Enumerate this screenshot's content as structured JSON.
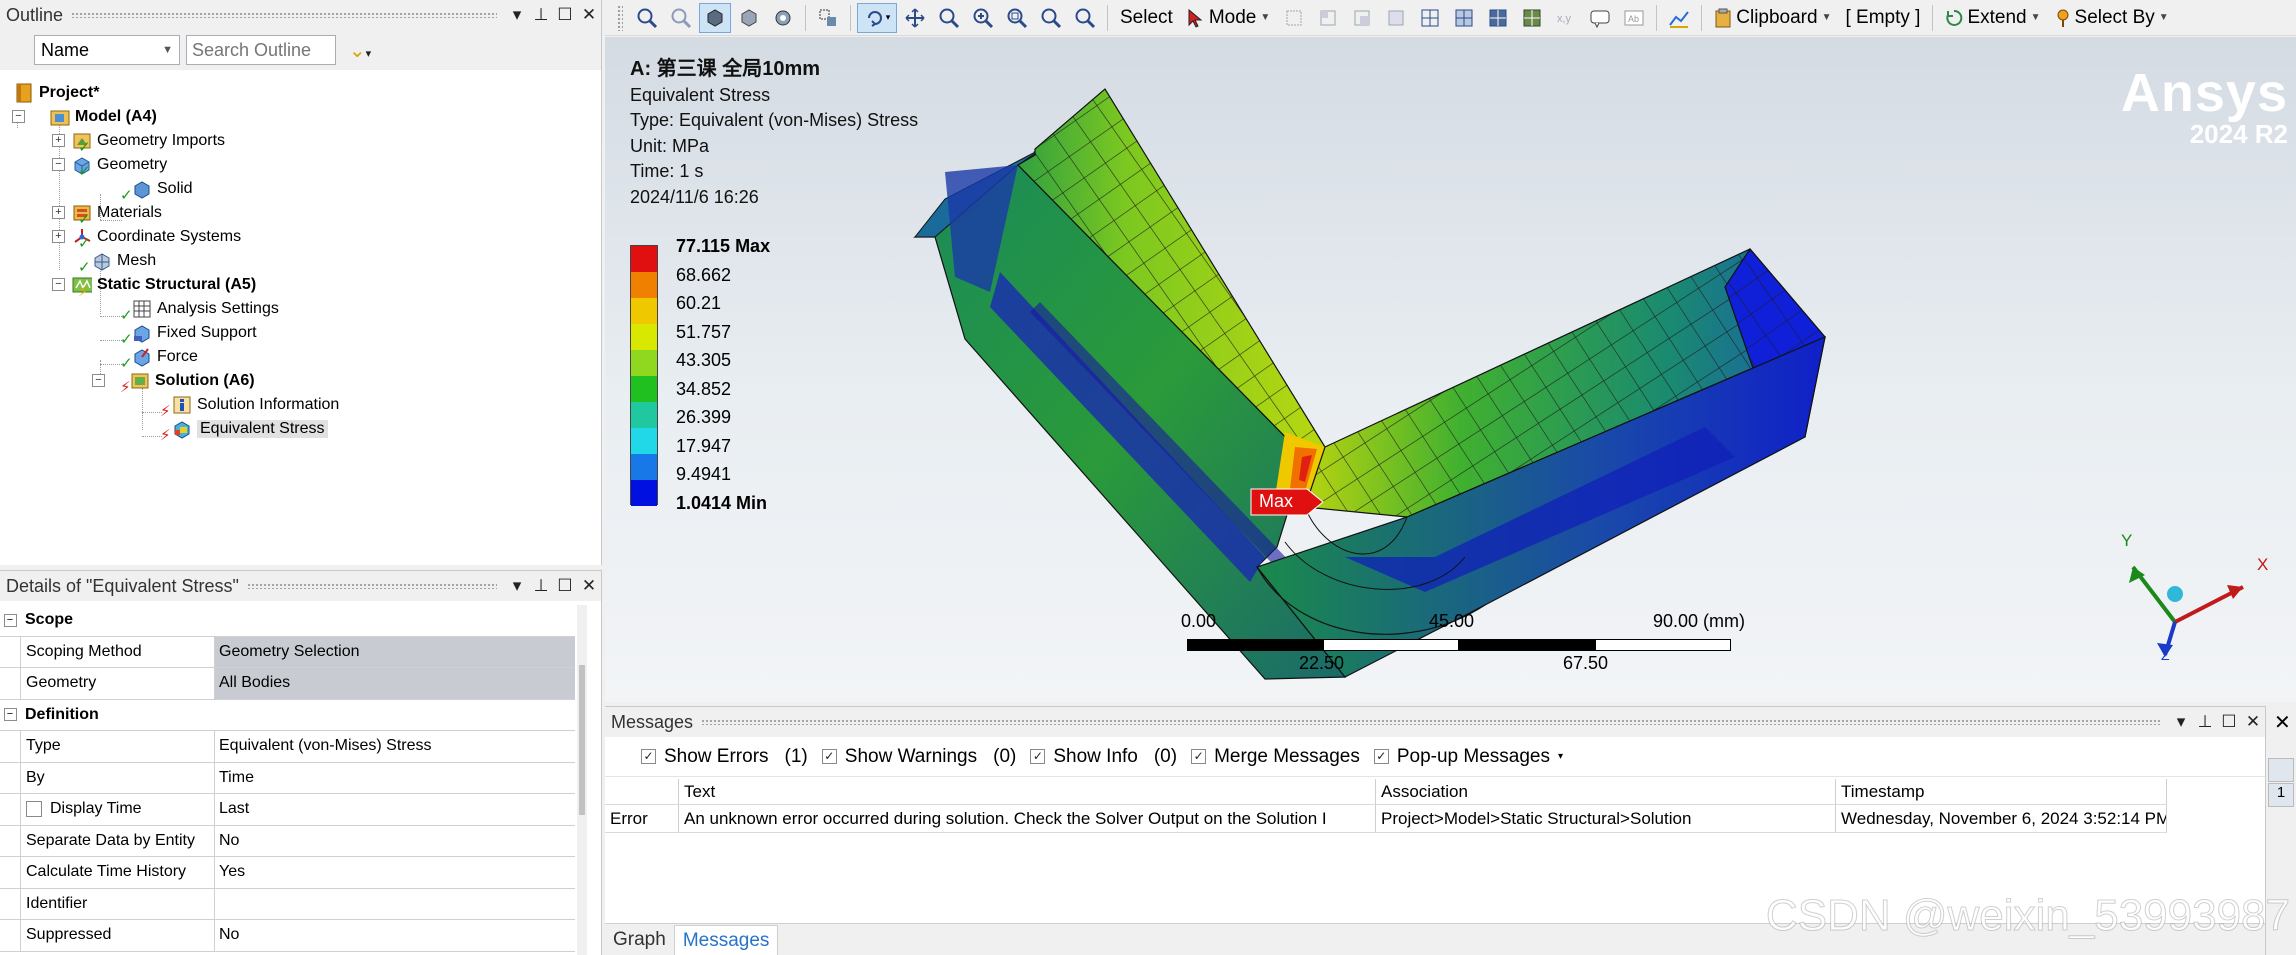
{
  "outline": {
    "title": "Outline",
    "filter_value": "Name",
    "search_placeholder": "Search Outline",
    "tree": {
      "project": "Project*",
      "model": "Model (A4)",
      "geometry_imports": "Geometry Imports",
      "geometry": "Geometry",
      "solid": "Solid",
      "materials": "Materials",
      "coordinate_systems": "Coordinate Systems",
      "mesh": "Mesh",
      "static_structural": "Static Structural (A5)",
      "analysis_settings": "Analysis Settings",
      "fixed_support": "Fixed Support",
      "force": "Force",
      "solution": "Solution (A6)",
      "solution_information": "Solution Information",
      "equivalent_stress": "Equivalent Stress"
    }
  },
  "details": {
    "title": "Details of \"Equivalent Stress\"",
    "groups": {
      "scope": "Scope",
      "definition": "Definition"
    },
    "rows": {
      "scoping_method": {
        "k": "Scoping Method",
        "v": "Geometry Selection"
      },
      "geometry": {
        "k": "Geometry",
        "v": "All Bodies"
      },
      "type": {
        "k": "Type",
        "v": "Equivalent (von-Mises) Stress"
      },
      "by": {
        "k": "By",
        "v": "Time"
      },
      "display_time": {
        "k": "Display Time",
        "v": "Last"
      },
      "separate": {
        "k": "Separate Data by Entity",
        "v": "No"
      },
      "calc_history": {
        "k": "Calculate Time History",
        "v": "Yes"
      },
      "identifier": {
        "k": "Identifier",
        "v": ""
      },
      "suppressed": {
        "k": "Suppressed",
        "v": "No"
      }
    }
  },
  "toolbar": {
    "select": "Select",
    "mode": "Mode",
    "clipboard": "Clipboard",
    "empty": "[ Empty ]",
    "extend": "Extend",
    "select_by": "Select By"
  },
  "viewport": {
    "title": "A: 第三课 全局10mm",
    "line1": "Equivalent Stress",
    "line2": "Type: Equivalent (von-Mises) Stress",
    "line3": "Unit: MPa",
    "line4": "Time: 1 s",
    "line5": "2024/11/6 16:26",
    "legend": {
      "max": "77.115 Max",
      "l1": "68.662",
      "l2": "60.21",
      "l3": "51.757",
      "l4": "43.305",
      "l5": "34.852",
      "l6": "26.399",
      "l7": "17.947",
      "l8": "9.4941",
      "min": "1.0414 Min",
      "colors": [
        "#e01010",
        "#f08000",
        "#f0c800",
        "#d8e800",
        "#90d820",
        "#20c020",
        "#20c8a0",
        "#20d8e8",
        "#1878e8",
        "#0010e0"
      ]
    },
    "brand": "Ansys",
    "version": "2024 R2",
    "max_tag": "Max",
    "scale": {
      "t0": "0.00",
      "t1": "45.00",
      "t2": "90.00 (mm)",
      "b1": "22.50",
      "b2": "67.50"
    },
    "triad": {
      "x": "X",
      "y": "Y",
      "z": "Z"
    }
  },
  "messages": {
    "title": "Messages",
    "show_errors": "Show Errors",
    "errors_count": "(1)",
    "show_warnings": "Show Warnings",
    "warnings_count": "(0)",
    "show_info": "Show Info",
    "info_count": "(0)",
    "merge": "Merge Messages",
    "popup": "Pop-up Messages",
    "columns": {
      "c0": "",
      "c1": "Text",
      "c2": "Association",
      "c3": "Timestamp"
    },
    "row": {
      "c0": "Error",
      "c1": "An unknown error occurred during solution.  Check the Solver Output on the Solution I",
      "c2": "Project>Model>Static Structural>Solution",
      "c3": "Wednesday, November 6, 2024 3:52:14 PM"
    },
    "tabs": {
      "graph": "Graph",
      "messages": "Messages"
    },
    "strip_cell": "1"
  },
  "watermark": "CSDN @weixin_53993987"
}
